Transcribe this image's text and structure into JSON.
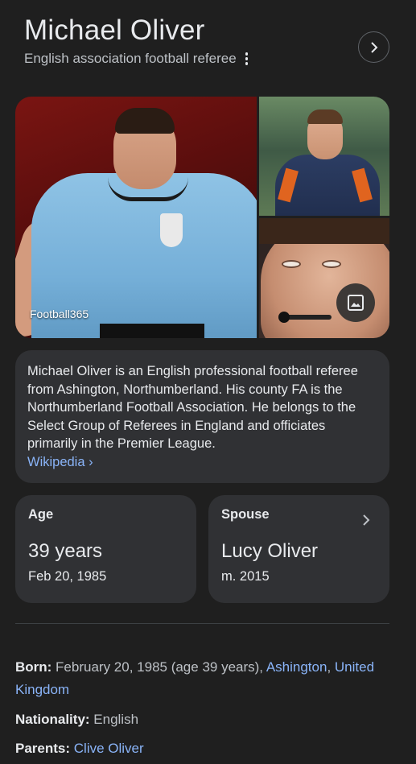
{
  "header": {
    "title": "Michael Oliver",
    "subtitle": "English association football referee"
  },
  "images": {
    "source_label": "Football365"
  },
  "description": {
    "text": "Michael Oliver is an English professional football referee from Ashington, Northumberland. His county FA is the Northumberland Football Association. He belongs to the Select Group of Referees in England and officiates primarily in the Premier League.",
    "source_link": "Wikipedia ›"
  },
  "facts_cards": {
    "age": {
      "label": "Age",
      "value": "39 years",
      "sub": "Feb 20, 1985"
    },
    "spouse": {
      "label": "Spouse",
      "value": "Lucy Oliver",
      "sub": "m. 2015"
    }
  },
  "facts": {
    "born": {
      "label": "Born:",
      "text": " February 20, 1985 (age 39 years), ",
      "link1": "Ashington",
      "sep": ", ",
      "link2": "United Kingdom"
    },
    "nationality": {
      "label": "Nationality:",
      "value": " English"
    },
    "parents": {
      "label": "Parents:",
      "link": "Clive Oliver"
    }
  },
  "colors": {
    "background": "#1f1f1f",
    "card": "#303134",
    "link": "#8ab4f8",
    "text": "#e8eaed",
    "muted": "#bdc1c6"
  },
  "icons": [
    "more-vert-icon",
    "chevron-right-icon",
    "image-icon"
  ]
}
